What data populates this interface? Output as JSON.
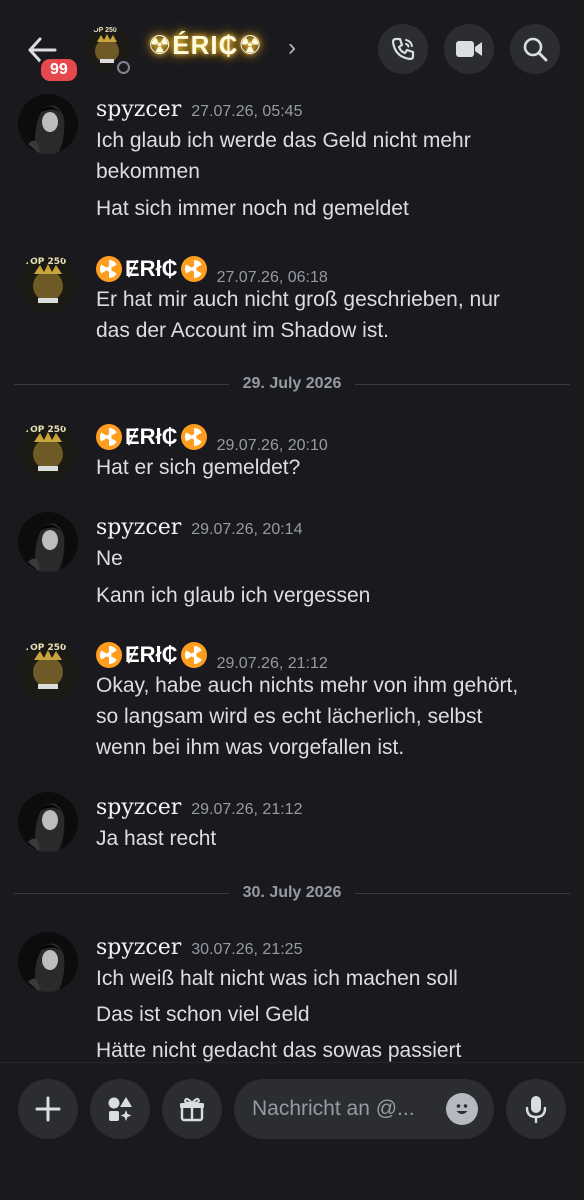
{
  "header": {
    "back_badge": "99",
    "avatar_text": "TOP 250",
    "name": "☢ÉRI₵☢",
    "chevron": "›"
  },
  "messages": [
    {
      "author": "spyzcer",
      "time": "27.07.26, 05:45",
      "lines": [
        "Ich glaub ich werde das Geld nicht mehr",
        "bekommen",
        "Hat sich immer noch nd gemeldet"
      ]
    },
    {
      "author": "ɆRł₵",
      "time": "27.07.26, 06:18",
      "lines": [
        "Er hat mir auch nicht groß geschrieben, nur",
        "das der Account im Shadow ist."
      ]
    },
    {
      "author": "ɆRł₵",
      "time": "29.07.26, 20:10",
      "lines": [
        "Hat er sich gemeldet?"
      ]
    },
    {
      "author": "spyzcer",
      "time": "29.07.26, 20:14",
      "lines": [
        "Ne",
        "Kann ich glaub ich vergessen"
      ]
    },
    {
      "author": "ɆRł₵",
      "time": "29.07.26, 21:12",
      "lines": [
        "Okay, habe auch nichts mehr von ihm gehört,",
        "so langsam wird es echt lächerlich, selbst",
        "wenn bei ihm was vorgefallen ist."
      ]
    },
    {
      "author": "spyzcer",
      "time": "29.07.26, 21:12",
      "lines": [
        "Ja hast recht"
      ]
    },
    {
      "author": "spyzcer",
      "time": "30.07.26, 21:25",
      "lines": [
        "Ich weiß halt nicht was ich machen soll",
        "Das ist schon viel Geld",
        "Hätte nicht gedacht das sowas passiert"
      ]
    }
  ],
  "dividers": [
    "29. July 2026",
    "30. July 2026"
  ],
  "composer": {
    "placeholder": "Nachricht an @..."
  },
  "colors": {
    "background": "#1a1a1e",
    "button_bg": "#2b2d31",
    "badge": "#e5484d",
    "radioactive": "#ff9d1e"
  }
}
